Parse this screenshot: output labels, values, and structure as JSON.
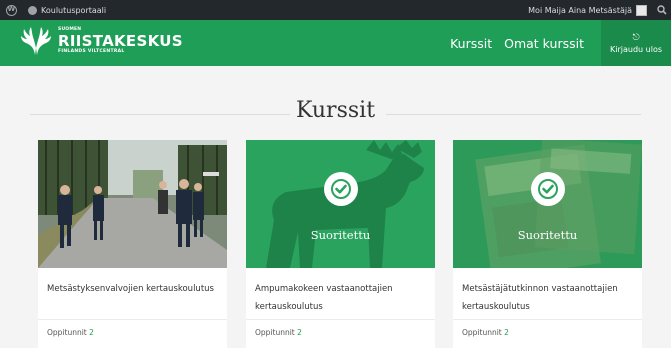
{
  "adminbar": {
    "site_name": "Koulutusportaali",
    "howdy": "Moi Maija Aina Metsästäjä"
  },
  "header": {
    "logo_small": "SUOMEN",
    "logo_big": "RIISTAKESKUS",
    "logo_sub": "FINLANDS VILTCENTRAL",
    "nav": {
      "kurssit": "Kurssit",
      "omat_kurssit": "Omat kurssit",
      "logout": "Kirjaudu ulos"
    }
  },
  "page": {
    "title": "Kurssit"
  },
  "courses": [
    {
      "name": "Metsästyksenvalvojien kertauskoulutus",
      "lessons_label": "Oppitunnit",
      "lessons_count": "2",
      "completed": ""
    },
    {
      "name": "Ampumakokeen vastaanottajien kertauskoulutus",
      "lessons_label": "Oppitunnit",
      "lessons_count": "2",
      "completed": "Suoritettu"
    },
    {
      "name": "Metsästäjätutkinnon vastaanottajien kertauskoulutus",
      "lessons_label": "Oppitunnit",
      "lessons_count": "2",
      "completed": "Suoritettu"
    }
  ],
  "colors": {
    "brand_green": "#1f9e57",
    "admin_bar": "#23282d",
    "overlay_green": "#28a05c"
  },
  "icons": [
    "wordpress-icon",
    "dashboard-icon",
    "avatar-icon",
    "search-icon",
    "logout-icon",
    "check-icon"
  ]
}
